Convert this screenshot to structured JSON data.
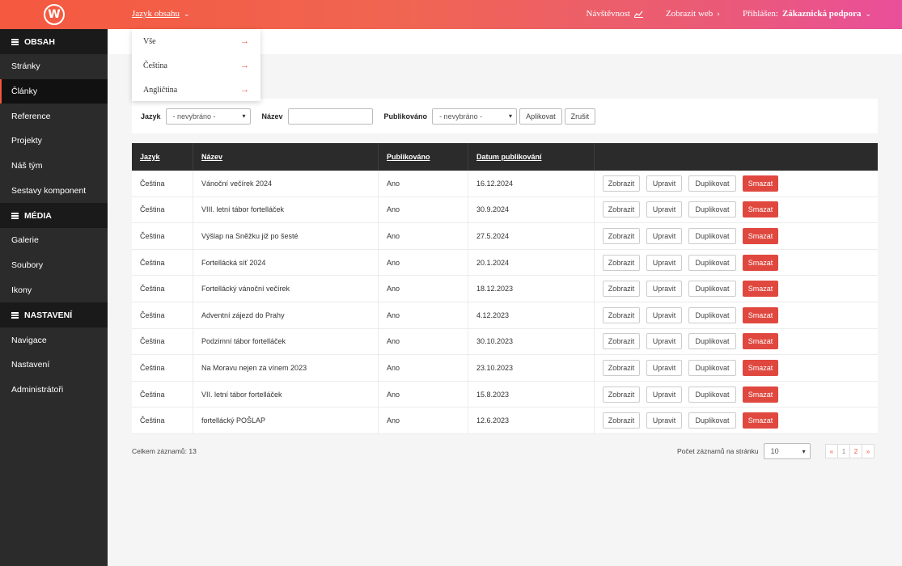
{
  "topbar": {
    "logo": "W",
    "lang_menu": "Jazyk obsahu",
    "visits": "Návštěvnost",
    "view_web": "Zobrazit web",
    "logged_in_label": "Přihlášen:",
    "logged_in_user": "Zákaznická podpora"
  },
  "language_dropdown": [
    {
      "label": "Vše",
      "arrow": "→"
    },
    {
      "label": "Čeština",
      "arrow": "→"
    },
    {
      "label": "Angličtina",
      "arrow": "→"
    }
  ],
  "sidebar": {
    "sections": [
      {
        "title": "OBSAH",
        "items": [
          "Stránky",
          "Články",
          "Reference",
          "Projekty",
          "Náš tým",
          "Sestavy komponent"
        ]
      },
      {
        "title": "MÉDIA",
        "items": [
          "Galerie",
          "Soubory",
          "Ikony"
        ]
      },
      {
        "title": "NASTAVENÍ",
        "items": [
          "Navigace",
          "Nastavení",
          "Administrátoři"
        ]
      }
    ],
    "active_item": "Články"
  },
  "filter": {
    "language_label": "Jazyk",
    "language_value": "- nevybráno -",
    "name_label": "Název",
    "name_value": "",
    "published_label": "Publikováno",
    "published_value": "- nevybráno -",
    "apply_button": "Aplikovat",
    "cancel_button": "Zrušit"
  },
  "table": {
    "columns": [
      "Jazyk",
      "Název",
      "Publikováno",
      "Datum publikování",
      ""
    ],
    "actions": {
      "view": "Zobrazit",
      "edit": "Upravit",
      "duplicate": "Duplikovat",
      "delete": "Smazat"
    },
    "rows": [
      [
        "Čeština",
        "Vánoční večírek 2024",
        "Ano",
        "16.12.2024"
      ],
      [
        "Čeština",
        "VIII. letní tábor fortelláček",
        "Ano",
        "30.9.2024"
      ],
      [
        "Čeština",
        "Výšlap na Sněžku již po šesté",
        "Ano",
        "27.5.2024"
      ],
      [
        "Čeština",
        "Fortellácká síť 2024",
        "Ano",
        "20.1.2024"
      ],
      [
        "Čeština",
        "Fortellácký vánoční večírek",
        "Ano",
        "18.12.2023"
      ],
      [
        "Čeština",
        "Adventní zájezd do Prahy",
        "Ano",
        "4.12.2023"
      ],
      [
        "Čeština",
        "Podzimní tábor fortelláček",
        "Ano",
        "30.10.2023"
      ],
      [
        "Čeština",
        "Na Moravu nejen za vínem 2023",
        "Ano",
        "23.10.2023"
      ],
      [
        "Čeština",
        "VII. letní tábor fortelláček",
        "Ano",
        "15.8.2023"
      ],
      [
        "Čeština",
        "fortellácký POŠLAP",
        "Ano",
        "12.6.2023"
      ]
    ]
  },
  "footer": {
    "total": "Celkem záznamů: 13",
    "per_page_label": "Počet záznamů na stránku",
    "per_page_value": "10",
    "pagination": [
      "«",
      "1",
      "2",
      "»"
    ],
    "current_page": "1"
  }
}
